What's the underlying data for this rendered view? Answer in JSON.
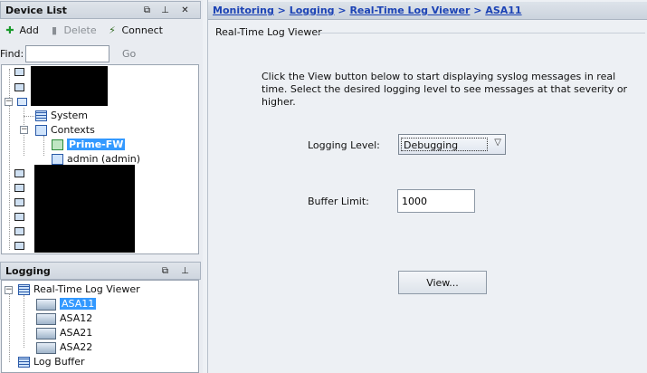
{
  "device_list": {
    "title": "Device List",
    "toolbar": {
      "add": "Add",
      "delete": "Delete",
      "connect": "Connect"
    },
    "find_label": "Find:",
    "find_value": "",
    "go_label": "Go",
    "tree": {
      "system": "System",
      "contexts": "Contexts",
      "prime_fw": "Prime-FW",
      "admin": "admin (admin)"
    }
  },
  "logging": {
    "title": "Logging",
    "tree": {
      "real_time_log_viewer": "Real-Time Log Viewer",
      "devices": [
        "ASA11",
        "ASA12",
        "ASA21",
        "ASA22"
      ],
      "selected_device": "ASA11",
      "log_buffer": "Log Buffer"
    }
  },
  "breadcrumb": {
    "monitoring": "Monitoring",
    "logging": "Logging",
    "viewer": "Real-Time Log Viewer",
    "device": "ASA11",
    "separator": ">"
  },
  "main": {
    "section_title": "Real-Time Log Viewer",
    "instructions": "Click the View button below to start displaying syslog messages in real time. Select the desired logging level to see messages at that severity or higher.",
    "logging_level_label": "Logging Level:",
    "logging_level_value": "Debugging",
    "buffer_limit_label": "Buffer Limit:",
    "buffer_limit_value": "1000",
    "view_button": "View..."
  },
  "icons": {
    "float": "restore-icon",
    "pin": "pin-icon",
    "close": "close-icon",
    "add": "plus-icon",
    "delete": "trash-icon",
    "connect": "connect-icon"
  },
  "colors": {
    "link": "#1c43b5",
    "selection": "#3399ff",
    "panel_header": "#cfd6df"
  }
}
